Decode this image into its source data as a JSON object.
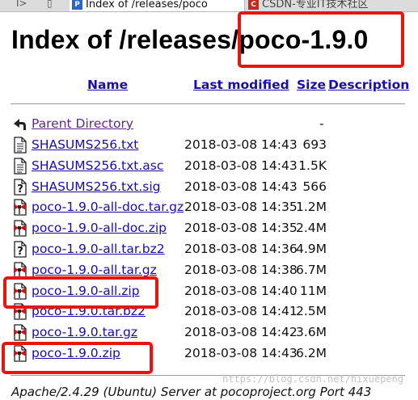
{
  "tabs": {
    "back_glyph": "I>",
    "new_tab_glyph": "▯",
    "active_title": "Index of /releases/poco",
    "csdn_title": "CSDN-专业IT技术社区"
  },
  "page": {
    "heading": "Index of /releases/poco-1.9.0"
  },
  "columns": {
    "name": "Name",
    "last_modified": "Last modified",
    "size": "Size",
    "description": "Description"
  },
  "parent": {
    "label": "Parent Directory",
    "size": "-"
  },
  "files": [
    {
      "name": "SHASUMS256.txt",
      "date": "2018-03-08 14:43",
      "size": "693",
      "icon": "text-file-icon"
    },
    {
      "name": "SHASUMS256.txt.asc",
      "date": "2018-03-08 14:43",
      "size": "1.5K",
      "icon": "text-file-icon"
    },
    {
      "name": "SHASUMS256.txt.sig",
      "date": "2018-03-08 14:43",
      "size": "566",
      "icon": "unknown-file-icon"
    },
    {
      "name": "poco-1.9.0-all-doc.tar.gz",
      "date": "2018-03-08 14:35",
      "size": "1.2M",
      "icon": "compressed-file-icon"
    },
    {
      "name": "poco-1.9.0-all-doc.zip",
      "date": "2018-03-08 14:35",
      "size": "2.4M",
      "icon": "compressed-file-icon"
    },
    {
      "name": "poco-1.9.0-all.tar.bz2",
      "date": "2018-03-08 14:36",
      "size": "4.9M",
      "icon": "unknown-file-icon"
    },
    {
      "name": "poco-1.9.0-all.tar.gz",
      "date": "2018-03-08 14:38",
      "size": "6.7M",
      "icon": "compressed-file-icon"
    },
    {
      "name": "poco-1.9.0-all.zip",
      "date": "2018-03-08 14:40",
      "size": "11M",
      "icon": "compressed-file-icon"
    },
    {
      "name": "poco-1.9.0.tar.bz2",
      "date": "2018-03-08 14:41",
      "size": "2.5M",
      "icon": "compressed-file-icon"
    },
    {
      "name": "poco-1.9.0.tar.gz",
      "date": "2018-03-08 14:42",
      "size": "3.6M",
      "icon": "compressed-file-icon"
    },
    {
      "name": "poco-1.9.0.zip",
      "date": "2018-03-08 14:43",
      "size": "6.2M",
      "icon": "compressed-file-icon"
    }
  ],
  "footer": {
    "address": "Apache/2.4.29 (Ubuntu) Server at pocoproject.org Port 443",
    "watermark": "https://blog.csdn.net/hixuepeng"
  },
  "colors": {
    "link": "#1a0dab",
    "visited": "#5e2a86",
    "annotation": "#e8150f"
  }
}
